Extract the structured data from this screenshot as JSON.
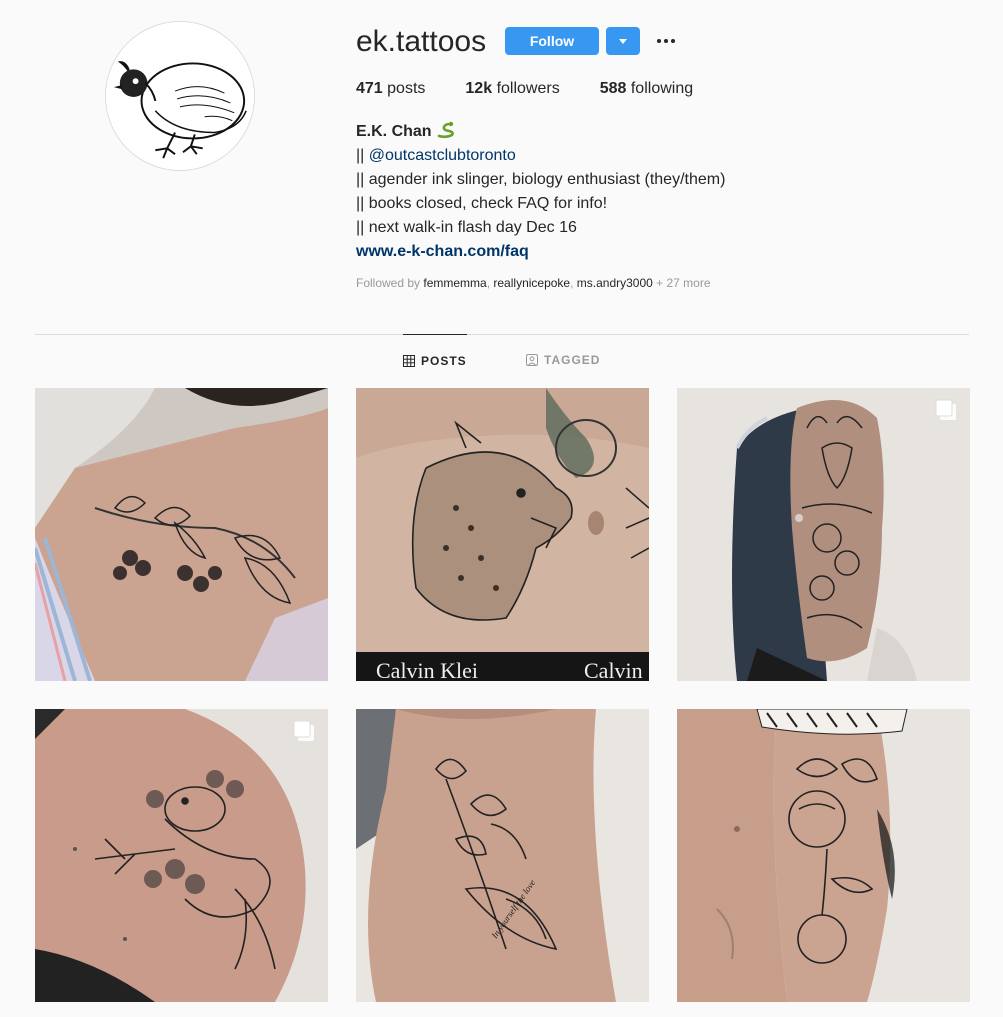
{
  "profile": {
    "username": "ek.tattoos",
    "follow_label": "Follow",
    "avatar_icon": "quail-illustration",
    "stats": {
      "posts_count": "471",
      "posts_label": "posts",
      "followers_count": "12k",
      "followers_label": "followers",
      "following_count": "588",
      "following_label": "following"
    },
    "bio": {
      "name": "E.K. Chan",
      "name_emoji": "snake-icon",
      "prefix1": "|| ",
      "mention": "@outcastclubtoronto",
      "line2": "|| agender ink slinger, biology enthusiast (they/them)",
      "line3": "|| books closed, check FAQ for info!",
      "line4": "|| next walk-in flash day Dec 16",
      "link": "www.e-k-chan.com/faq"
    },
    "followed_by": {
      "prefix": "Followed by ",
      "names": [
        "femmemma",
        "reallynicepoke",
        "ms.andry3000"
      ],
      "sep": ", ",
      "more": " + 27 more"
    }
  },
  "tabs": [
    {
      "label": "POSTS",
      "icon": "grid-icon",
      "active": true
    },
    {
      "label": "TAGGED",
      "icon": "tagged-icon",
      "active": false
    }
  ],
  "posts": [
    {
      "subject": "cherry-branch-shoulder-tattoo",
      "multi": false
    },
    {
      "subject": "hyena-belly-tattoo",
      "multi": false
    },
    {
      "subject": "stag-sleeve-tattoo",
      "multi": true
    },
    {
      "subject": "mouse-flowers-shoulder-tattoo",
      "multi": true
    },
    {
      "subject": "orchid-banner-arm-tattoo",
      "multi": false
    },
    {
      "subject": "peach-branch-arm-tattoo",
      "multi": false
    }
  ],
  "colors": {
    "accent": "#3897f0",
    "link": "#003569",
    "background": "#fafafa",
    "muted": "#999999"
  }
}
